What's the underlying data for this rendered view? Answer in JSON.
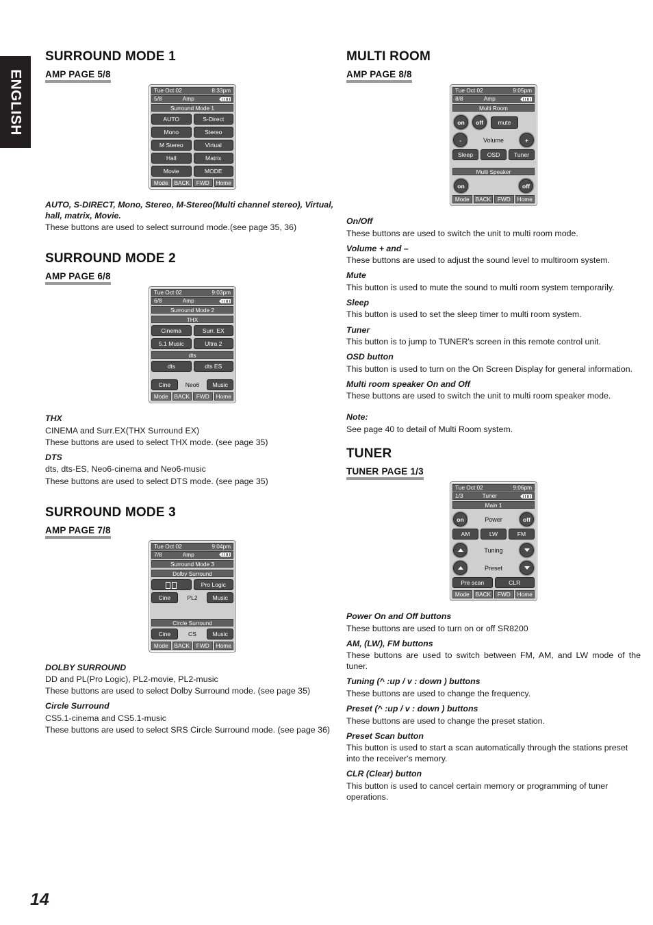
{
  "sidebar": {
    "language_tab": "ENGLISH"
  },
  "page_number": "14",
  "left_column": {
    "sections": [
      {
        "title": "SURROUND MODE 1",
        "subhead": "AMP PAGE 5/8",
        "lcd": {
          "date": "Tue Oct 02",
          "time": "8:33pm",
          "page": "5/8",
          "mode": "Amp",
          "screen_title": "Surround Mode 1",
          "buttons": [
            [
              "AUTO",
              "S-Direct"
            ],
            [
              "Mono",
              "Stereo"
            ],
            [
              "M Stereo",
              "Virtual"
            ],
            [
              "Hall",
              "Matrix"
            ],
            [
              "Movie",
              "MODE"
            ]
          ],
          "nav": [
            "Mode",
            "BACK",
            "FWD",
            "Home"
          ]
        },
        "descriptions": [
          {
            "title": "AUTO, S-DIRECT, Mono, Stereo, M-Stereo(Multi channel stereo), Virtual, hall, matrix, Movie.",
            "body": "These buttons are used to select surround mode.(see page 35, 36)"
          }
        ]
      },
      {
        "title": "SURROUND MODE 2",
        "subhead": "AMP PAGE 6/8",
        "lcd": {
          "date": "Tue Oct 02",
          "time": "9:03pm",
          "page": "6/8",
          "mode": "Amp",
          "screen_title": "Surround Mode 2",
          "group1_label": "THX",
          "group1_rows": [
            [
              "Cinema",
              "Surr. EX"
            ],
            [
              "5.1 Music",
              "Ultra 2"
            ]
          ],
          "group2_label": "dts",
          "group2_rows": [
            [
              "dts",
              "dts ES"
            ]
          ],
          "group3_row": [
            "Cine",
            "Neo6",
            "Music"
          ],
          "nav": [
            "Mode",
            "BACK",
            "FWD",
            "Home"
          ]
        },
        "descriptions": [
          {
            "title": "THX",
            "body": "CINEMA and Surr.EX(THX Surround EX)",
            "body2": "These buttons are used to select THX mode. (see page 35)"
          },
          {
            "title": "DTS",
            "body": "dts, dts-ES, Neo6-cinema and Neo6-music",
            "body2": "These buttons are used to select DTS mode. (see page 35)"
          }
        ]
      },
      {
        "title": "SURROUND MODE 3",
        "subhead": "AMP PAGE 7/8",
        "lcd": {
          "date": "Tue Oct 02",
          "time": "9:04pm",
          "page": "7/8",
          "mode": "Amp",
          "screen_title": "Surround Mode 3",
          "group1_label": "Dolby Surround",
          "dolby_row_right": "Pro Logic",
          "group1_row2": [
            "Cine",
            "PL2",
            "Music"
          ],
          "group2_label": "Circle Surround",
          "group2_row": [
            "Cine",
            "CS",
            "Music"
          ],
          "nav": [
            "Mode",
            "BACK",
            "FWD",
            "Home"
          ]
        },
        "descriptions": [
          {
            "title": "DOLBY SURROUND",
            "body": "DD and PL(Pro Logic), PL2-movie, PL2-music",
            "body2": "These buttons are used to select Dolby Surround mode. (see page 35)"
          },
          {
            "title": "Circle Surround",
            "body": "CS5.1-cinema and CS5.1-music",
            "body2": "These buttons are used to select SRS Circle Surround mode. (see page 36)"
          }
        ]
      }
    ]
  },
  "right_column": {
    "sections": [
      {
        "title": "MULTI ROOM",
        "subhead": "AMP PAGE 8/8",
        "lcd": {
          "date": "Tue Oct 02",
          "time": "9:05pm",
          "page": "8/8",
          "mode": "Amp",
          "screen_title": "Multi Room",
          "on": "on",
          "off": "off",
          "mute": "mute",
          "minus": "-",
          "plus": "+",
          "volume": "Volume",
          "row_buttons": [
            "Sleep",
            "OSD",
            "Tuner"
          ],
          "speaker_label": "Multi Speaker",
          "speaker_on": "on",
          "speaker_off": "off",
          "nav": [
            "Mode",
            "BACK",
            "FWD",
            "Home"
          ]
        },
        "descriptions": [
          {
            "title": "On/Off",
            "body": "These buttons are used to switch the unit to multi room mode."
          },
          {
            "title": "Volume + and –",
            "body": "These buttons are used to adjust the sound level to multiroom system."
          },
          {
            "title": "Mute",
            "body": "This button is used to mute the sound  to multi room system temporarily."
          },
          {
            "title": "Sleep",
            "body": "This button is used to set the sleep timer to multi room system."
          },
          {
            "title": "Tuner",
            "body": "This button is to jump to TUNER's screen in this remote control unit."
          },
          {
            "title": "OSD button",
            "body": "This button is used to turn on the On Screen Display for general information."
          },
          {
            "title": "Multi room speaker On and Off",
            "body": "These buttons are used to switch the unit to multi room speaker mode."
          },
          {
            "title": "Note:",
            "body": "See page 40 to detail of Multi Room system."
          }
        ]
      },
      {
        "title": "TUNER",
        "subhead": "TUNER PAGE 1/3",
        "lcd": {
          "date": "Tue Oct 02",
          "time": "9:06pm",
          "page": "1/3",
          "mode": "Tuner",
          "screen_title": "Main 1",
          "on": "on",
          "off": "off",
          "power": "Power",
          "band_buttons": [
            "AM",
            "LW",
            "FM"
          ],
          "tuning": "Tuning",
          "preset": "Preset",
          "bottom_buttons": [
            "Pre scan",
            "CLR"
          ],
          "nav": [
            "Mode",
            "BACK",
            "FWD",
            "Home"
          ]
        },
        "descriptions": [
          {
            "title": "Power On and Off buttons",
            "body": " These buttons are used to turn on or off SR8200"
          },
          {
            "title": "AM, (LW), FM buttons",
            "body": "These buttons are used to switch between FM, AM, and LW mode of the tuner."
          },
          {
            "title": "Tuning (^ :up / v : down ) buttons",
            "body": "These buttons are used to change the frequency."
          },
          {
            "title": "Preset (^ :up / v : down ) buttons",
            "body": "These buttons are used to change the preset station."
          },
          {
            "title": "Preset Scan button",
            "body": "This button is used to start a scan automatically through the stations preset into the receiver's memory."
          },
          {
            "title": "CLR (Clear) button",
            "body": "This button is used to cancel certain memory or programming of tuner operations."
          }
        ]
      }
    ]
  },
  "colors": {
    "tab_bg": "#231f20",
    "lcd_bg": "#cfcfcf",
    "lcd_btn": "#4a4a4a",
    "lcd_bar": "#5e5e5e",
    "rule": "#9b9b9b"
  }
}
